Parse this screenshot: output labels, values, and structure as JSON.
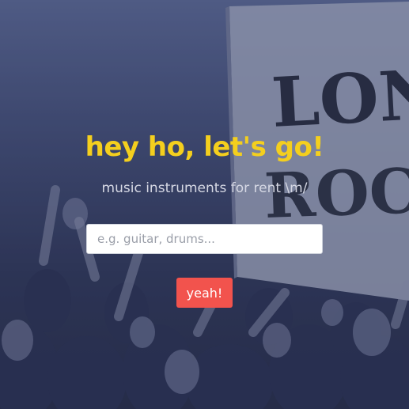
{
  "hero": {
    "headline": "hey ho, let's go!",
    "subtitle": "music instruments for rent \\m/",
    "search": {
      "placeholder": "e.g. guitar, drums...",
      "value": ""
    },
    "submit_label": "yeah!"
  },
  "background": {
    "description_icon": "crowd-photo",
    "sign_text": "LONG ROCK"
  },
  "colors": {
    "headline": "#f4cf1e",
    "subtitle": "#d6d8e4",
    "button": "#f2534d",
    "overlay": "#2f3656"
  }
}
